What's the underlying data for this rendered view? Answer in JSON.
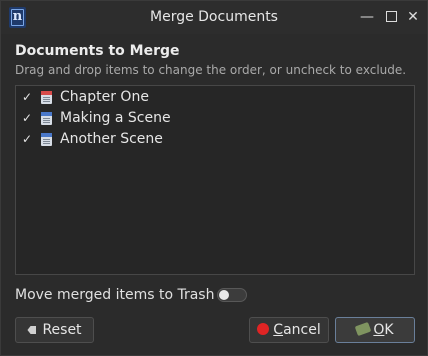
{
  "window": {
    "title": "Merge Documents",
    "app_icon_letter": "n",
    "min_glyph": "—",
    "close_glyph": "✕"
  },
  "section": {
    "title": "Documents to Merge",
    "subtitle": "Drag and drop items to change the order, or uncheck to exclude."
  },
  "documents": [
    {
      "label": "Chapter One",
      "checked": true,
      "icon": "chapter-doc-icon",
      "icon_color": "#d74b4b"
    },
    {
      "label": "Making a Scene",
      "checked": true,
      "icon": "scene-doc-icon",
      "icon_color": "#4a78c9"
    },
    {
      "label": "Another Scene",
      "checked": true,
      "icon": "scene-doc-icon",
      "icon_color": "#4a78c9"
    }
  ],
  "check_glyph": "✓",
  "trash_option": {
    "label": "Move merged items to Trash",
    "enabled": false
  },
  "buttons": {
    "reset": {
      "label": "Reset"
    },
    "cancel": {
      "label_first": "C",
      "label_rest": "ancel"
    },
    "ok": {
      "label_first": "O",
      "label_rest": "K"
    }
  }
}
